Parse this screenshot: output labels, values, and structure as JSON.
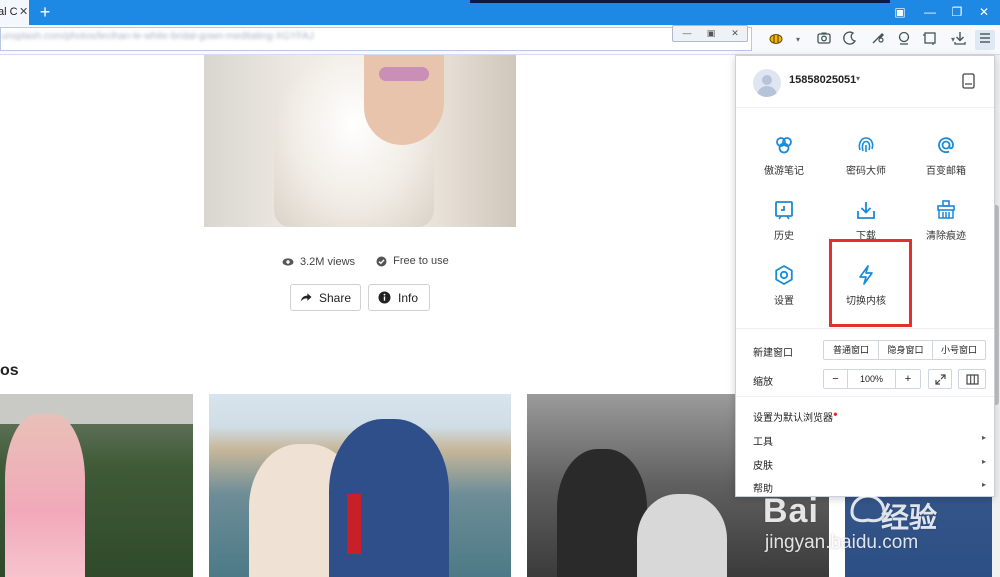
{
  "tabbar": {
    "active_tab_title": "al C",
    "close_glyph": "✕",
    "new_tab_glyph": "+",
    "window_controls": [
      "▣",
      "—",
      "❐",
      "✕"
    ]
  },
  "address_bar": {
    "url_blurred": "unsplash.com/photos/lecihan-le-white-bridal-gown-meditating-XGYFAJ",
    "mini_window_controls": [
      "—",
      "▣",
      "✕"
    ]
  },
  "toolbar": {
    "icons": [
      "bee-extension-icon",
      "dropdown-caret-icon",
      "screenshot-icon",
      "night-mode-icon",
      "tools-icon",
      "proxy-icon",
      "crop-icon",
      "download-icon",
      "menu-icon"
    ]
  },
  "photo_page": {
    "views": "3.2M views",
    "license": "Free to use",
    "share_label": "Share",
    "info_label": "Info",
    "section_heading": "os"
  },
  "menu": {
    "username": "15858025051",
    "username_caret": "▾",
    "grid": [
      {
        "label": "傲游笔记",
        "icon": "notes-icon"
      },
      {
        "label": "密码大师",
        "icon": "fingerprint-icon"
      },
      {
        "label": "百变邮箱",
        "icon": "at-sign-icon"
      },
      {
        "label": "历史",
        "icon": "history-icon"
      },
      {
        "label": "下载",
        "icon": "download-tray-icon"
      },
      {
        "label": "清除痕迹",
        "icon": "broom-icon"
      },
      {
        "label": "设置",
        "icon": "gear-icon"
      },
      {
        "label": "切换内核",
        "icon": "lightning-icon"
      }
    ],
    "new_window_label": "新建窗口",
    "new_window_options": [
      "普通窗口",
      "隐身窗口",
      "小号窗口"
    ],
    "zoom_label": "缩放",
    "zoom_minus": "−",
    "zoom_value": "100%",
    "zoom_plus": "+",
    "set_default": "设置为默认浏览器",
    "set_default_dot": "●",
    "tools": "工具",
    "skins": "皮肤",
    "help": "帮助",
    "submenu_arrow": "▸"
  },
  "watermark": {
    "brand_left": "Bai",
    "brand_right": "经验",
    "url": "jingyan.baidu.com"
  },
  "colors": {
    "tabbar": "#1e88e5",
    "menu_icon_blue": "#1a8bd8",
    "highlight": "#e52f2f"
  }
}
